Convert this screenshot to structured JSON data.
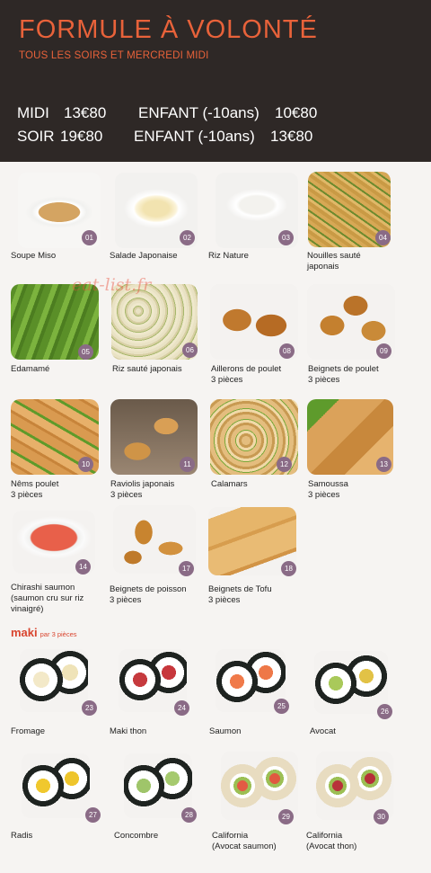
{
  "header": {
    "title": "FORMULE À VOLONTÉ",
    "subtitle": "TOUS LES SOIRS ET MERCREDI MIDI",
    "prices": [
      {
        "label": "MIDI",
        "price": "13€80",
        "child_label": "ENFANT (-10ans)",
        "child_price": "10€80"
      },
      {
        "label": "SOIR",
        "price": "19€80",
        "child_label": "ENFANT (-10ans)",
        "child_price": "13€80"
      }
    ]
  },
  "watermark": "eat-list.fr",
  "dishes": [
    {
      "num": "01",
      "name": "Soupe Miso",
      "extra": ""
    },
    {
      "num": "02",
      "name": "Salade Japonaise",
      "extra": ""
    },
    {
      "num": "03",
      "name": "Riz Nature",
      "extra": ""
    },
    {
      "num": "04",
      "name": "Nouilles sauté",
      "extra": "japonais"
    },
    {
      "num": "05",
      "name": "Edamamé",
      "extra": ""
    },
    {
      "num": "06",
      "name": "Riz sauté japonais",
      "extra": ""
    },
    {
      "num": "08",
      "name": "Aillerons de poulet",
      "extra": "3 pièces"
    },
    {
      "num": "09",
      "name": "Beignets de poulet",
      "extra": "3 pièces"
    },
    {
      "num": "10",
      "name": "Nêms poulet",
      "extra": "3 pièces"
    },
    {
      "num": "11",
      "name": "Raviolis japonais",
      "extra": "3 pièces"
    },
    {
      "num": "12",
      "name": "Calamars",
      "extra": ""
    },
    {
      "num": "13",
      "name": "Samoussa",
      "extra": "3 pièces"
    },
    {
      "num": "14",
      "name": "Chirashi saumon",
      "extra": "(saumon cru sur riz",
      "extra2": "vinaigré)"
    },
    {
      "num": "17",
      "name": "Beignets de poisson",
      "extra": "3 pièces"
    },
    {
      "num": "18",
      "name": "Beignets de Tofu",
      "extra": "3 pièces"
    }
  ],
  "maki_section": {
    "title": "maki",
    "note": "par 3 pièces"
  },
  "maki": [
    {
      "num": "23",
      "name": "Fromage",
      "extra": ""
    },
    {
      "num": "24",
      "name": "Maki thon",
      "extra": ""
    },
    {
      "num": "25",
      "name": "Saumon",
      "extra": ""
    },
    {
      "num": "26",
      "name": "Avocat",
      "extra": ""
    },
    {
      "num": "27",
      "name": "Radis",
      "extra": ""
    },
    {
      "num": "28",
      "name": "Concombre",
      "extra": ""
    },
    {
      "num": "29",
      "name": "California",
      "extra": "(Avocat saumon)"
    },
    {
      "num": "30",
      "name": "California",
      "extra": "(Avocat thon)"
    }
  ],
  "colors": {
    "header_bg": "#2e2826",
    "title": "#e8623a",
    "badge": "#8a6b86",
    "maki_title": "#d9452f"
  }
}
